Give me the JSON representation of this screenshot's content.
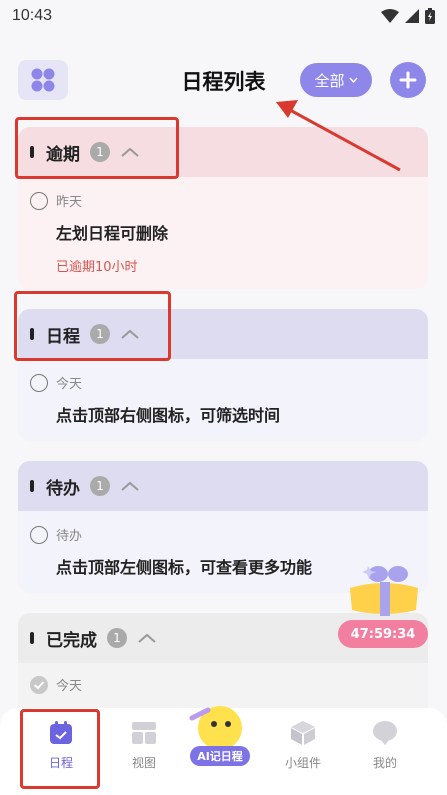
{
  "status_bar": {
    "time": "10:43"
  },
  "header": {
    "title": "日程列表",
    "filter_label": "全部"
  },
  "sections": [
    {
      "key": "overdue",
      "label": "逾期",
      "count": "1",
      "head_color": "#f6dde2",
      "body_color": "#fcf2f4",
      "tasks": [
        {
          "date": "昨天",
          "title": "左划日程可删除",
          "note": "已逾期10小时"
        }
      ]
    },
    {
      "key": "schedule",
      "label": "日程",
      "count": "1",
      "head_color": "#dddcf0",
      "body_color": "#f3f3fb",
      "tasks": [
        {
          "date": "今天",
          "title": "点击顶部右侧图标，可筛选时间"
        }
      ]
    },
    {
      "key": "todo",
      "label": "待办",
      "count": "1",
      "head_color": "#dddcf0",
      "body_color": "#f3f3fb",
      "tasks": [
        {
          "date": "待办",
          "title": "点击顶部左侧图标，可查看更多功能"
        }
      ]
    },
    {
      "key": "done",
      "label": "已完成",
      "count": "1",
      "head_color": "#ececec",
      "body_color": "#f3f3f3",
      "tasks": [
        {
          "date": "今天"
        }
      ]
    }
  ],
  "timer": "47:59:34",
  "tabbar": {
    "items": [
      {
        "label": "日程",
        "icon": "calendar-icon",
        "active": true
      },
      {
        "label": "视图",
        "icon": "layout-icon"
      },
      {
        "label": "小组件",
        "icon": "cube-icon"
      },
      {
        "label": "我的",
        "icon": "profile-icon"
      }
    ],
    "ai_label": "AI记日程"
  },
  "colors": {
    "accent": "#8f86ea",
    "annotation_red": "#d9392f",
    "overdue_red": "#d9534f"
  }
}
